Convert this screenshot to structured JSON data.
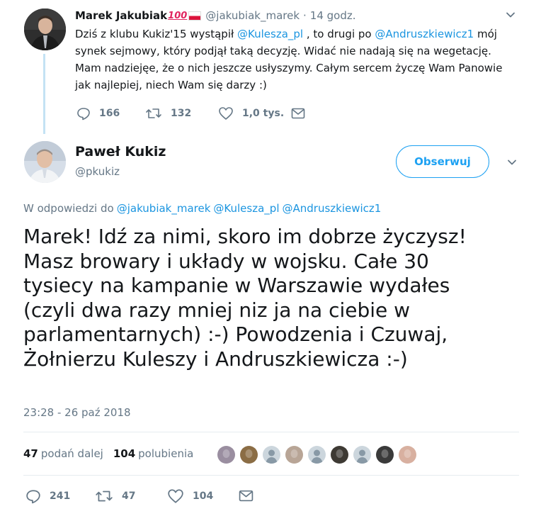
{
  "colors": {
    "accent": "#1da1f2",
    "link": "#1b95e0",
    "muted": "#657786",
    "text": "#14171a",
    "thread_line": "#c4e2f4"
  },
  "parent_tweet": {
    "author_name": "Marek Jakubiak",
    "emoji": "100",
    "flag_icon": "poland-flag-icon",
    "handle": "@jakubiak_marek",
    "separator": "·",
    "time": "14 godz.",
    "text_parts": [
      "Dziś z klubu Kukiz'15 wystąpił ",
      "@Kulesza_pl",
      " , to drugi po ",
      "@Andruszkiewicz1",
      " mój synek sejmowy, który podjął taką decyzję. Widać nie nadają się na wegetację. Mam nadziejęe, że o nich jeszcze usłyszymy. Całym sercem życzę Wam Panowie jak najlepiej, niech Wam się darzy :)"
    ],
    "reply_count": "166",
    "retweet_count": "132",
    "like_count": "1,0 tys."
  },
  "main_tweet": {
    "author_name": "Paweł Kukiz",
    "handle": "@pkukiz",
    "follow_label": "Obserwuj",
    "reply_prefix": "W odpowiedzi do",
    "reply_mentions": [
      "@jakubiak_marek",
      "@Kulesza_pl",
      "@Andruszkiewicz1"
    ],
    "lines": [
      "Marek! Idź za nimi, skoro im dobrze życzysz!",
      "Masz browary i układy w wojsku. Całe 30",
      "tysiecy na kampanie w Warszawie wydałes",
      "(czyli dwa razy mniej niz ja na ciebie w",
      "parlamentarnych) :-) Powodzenia i Czuwaj,",
      "Żołnierzu Kuleszy i Andruszkiewicza :-)"
    ],
    "timestamp": "23:28 - 26 paź 2018",
    "retweets": {
      "count": "47",
      "label": "podań dalej"
    },
    "likes": {
      "count": "104",
      "label": "polubienia"
    },
    "reply_count": "241",
    "retweet_count": "47",
    "like_count": "104",
    "liker_avatars": [
      "#9a8ea0",
      "#8b6d45",
      "#ccd6dd",
      "#b8a596",
      "#ccd6dd",
      "#3e3a34",
      "#ccd6dd",
      "#3a3a3a",
      "#d8b0a0"
    ]
  }
}
